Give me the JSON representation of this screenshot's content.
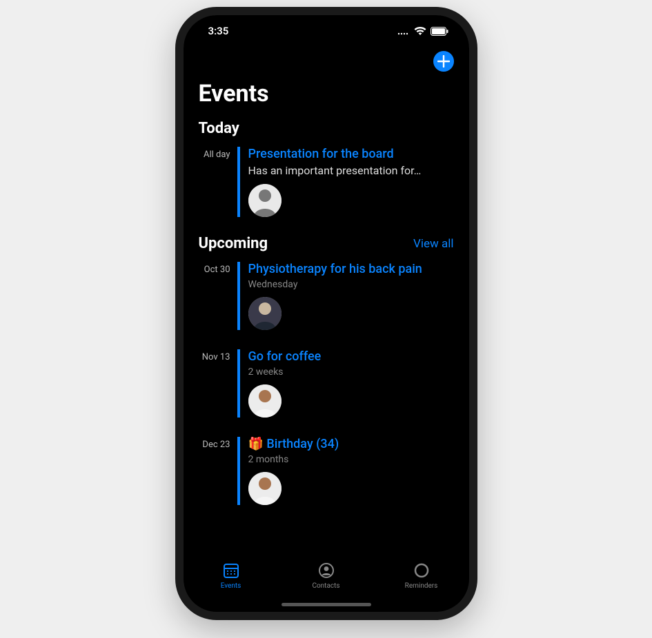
{
  "status": {
    "time": "3:35"
  },
  "header": {
    "title": "Events"
  },
  "sections": {
    "today": {
      "label": "Today",
      "items": [
        {
          "date_label": "All day",
          "title": "Presentation for the board",
          "subtitle": "Has an important presentation for…"
        }
      ]
    },
    "upcoming": {
      "label": "Upcoming",
      "view_all": "View all",
      "items": [
        {
          "date_label": "Oct 30",
          "title": "Physiotherapy for his back pain",
          "subtitle": "Wednesday"
        },
        {
          "date_label": "Nov 13",
          "title": "Go for coffee",
          "subtitle": "2 weeks"
        },
        {
          "date_label": "Dec 23",
          "title": "🎁 Birthday (34)",
          "subtitle": "2 months"
        }
      ]
    }
  },
  "tabs": {
    "events": "Events",
    "contacts": "Contacts",
    "reminders": "Reminders"
  },
  "accent_color": "#0a84ff"
}
